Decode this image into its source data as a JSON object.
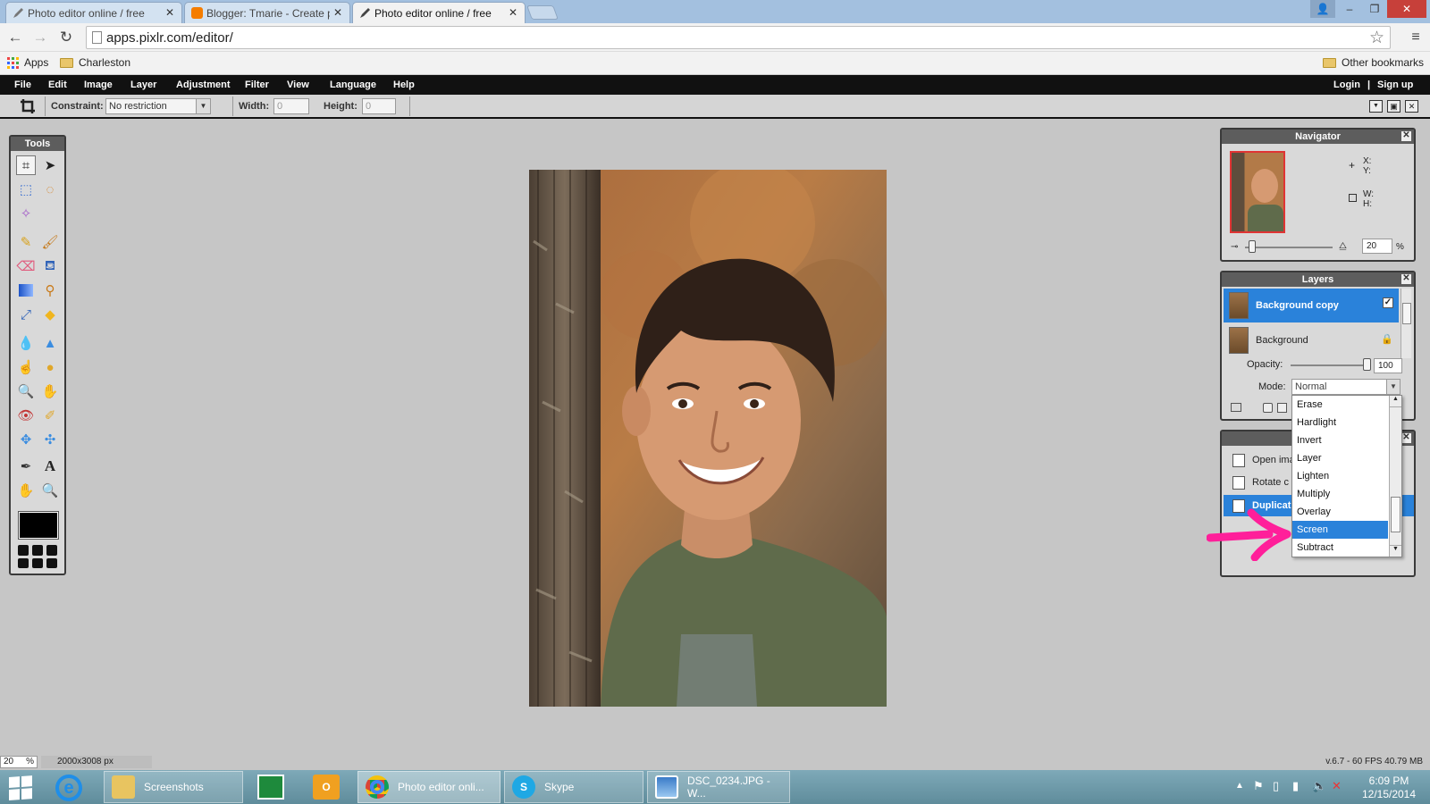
{
  "browser": {
    "tabs": [
      {
        "title": "Photo editor online / free",
        "active": false
      },
      {
        "title": "Blogger: Tmarie - Create p",
        "active": false
      },
      {
        "title": "Photo editor online / free",
        "active": true
      }
    ],
    "url": "apps.pixlr.com/editor/",
    "bookmarks": [
      {
        "label": "Apps"
      },
      {
        "label": "Charleston"
      }
    ],
    "other_bookmarks": "Other bookmarks"
  },
  "menubar": {
    "items": [
      "File",
      "Edit",
      "Image",
      "Layer",
      "Adjustment",
      "Filter",
      "View",
      "Language",
      "Help"
    ],
    "login": "Login",
    "separator": "|",
    "signup": "Sign up"
  },
  "options": {
    "constraint_label": "Constraint:",
    "constraint_value": "No restriction",
    "width_label": "Width:",
    "width_value": "0",
    "height_label": "Height:",
    "height_value": "0"
  },
  "tools_panel": {
    "title": "Tools"
  },
  "navigator": {
    "title": "Navigator",
    "x_label": "X:",
    "y_label": "Y:",
    "w_label": "W:",
    "h_label": "H:",
    "zoom_value": "20",
    "zoom_unit": "%"
  },
  "layers": {
    "title": "Layers",
    "items": [
      {
        "name": "Background copy",
        "selected": true
      },
      {
        "name": "Background",
        "selected": false
      }
    ],
    "opacity_label": "Opacity:",
    "opacity_value": "100",
    "mode_label": "Mode:",
    "mode_value": "Normal",
    "mode_options": [
      "Erase",
      "Hardlight",
      "Invert",
      "Layer",
      "Lighten",
      "Multiply",
      "Overlay",
      "Screen",
      "Subtract"
    ],
    "mode_highlighted": "Screen"
  },
  "history": {
    "items": [
      "Open ima",
      "Rotate c",
      "Duplicat"
    ]
  },
  "status": {
    "zoom": "20",
    "zoom_unit": "%",
    "dimensions": "2000x3008 px",
    "version": "v.6.7 - 60 FPS 40.79 MB"
  },
  "taskbar": {
    "buttons": [
      {
        "label": "Screenshots"
      },
      {
        "label": "Photo editor onli..."
      },
      {
        "label": "Skype"
      },
      {
        "label": "DSC_0234.JPG - W..."
      }
    ],
    "time": "6:09 PM",
    "date": "12/15/2014"
  },
  "colors": {
    "pixlr_menubar": "#111111",
    "selection_blue": "#2a82da",
    "annotation_arrow": "#ff1f9a",
    "taskbar": "#6e9aa9"
  }
}
